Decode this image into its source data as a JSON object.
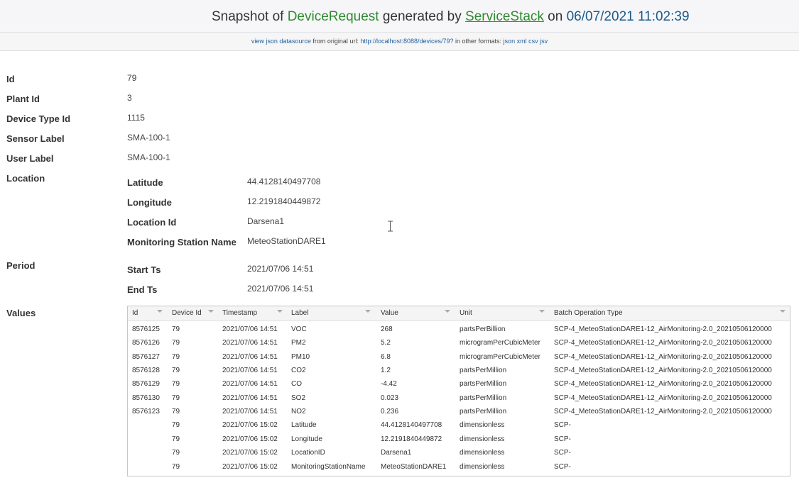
{
  "header": {
    "prefix": "Snapshot of ",
    "dto_name": "DeviceRequest",
    "generated_by": " generated by ",
    "servicestack": "ServiceStack",
    "on": " on ",
    "datetime": "06/07/2021 11:02:39"
  },
  "subheader": {
    "view_json": "view json datasource",
    "from_original": " from original url: ",
    "url": "http://localhost:8088/devices/79?",
    "other_formats": " in other formats: ",
    "formats": [
      "json",
      "xml",
      "csv",
      "jsv"
    ]
  },
  "fields": {
    "id": {
      "label": "Id",
      "value": "79"
    },
    "plant_id": {
      "label": "Plant Id",
      "value": "3"
    },
    "device_type_id": {
      "label": "Device Type Id",
      "value": "1115"
    },
    "sensor_label": {
      "label": "Sensor Label",
      "value": "SMA-100-1"
    },
    "user_label": {
      "label": "User Label",
      "value": "SMA-100-1"
    },
    "location": {
      "label": "Location",
      "latitude": {
        "label": "Latitude",
        "value": "44.4128140497708"
      },
      "longitude": {
        "label": "Longitude",
        "value": "12.2191840449872"
      },
      "location_id": {
        "label": "Location Id",
        "value": "Darsena1"
      },
      "monitoring_station_name": {
        "label": "Monitoring Station Name",
        "value": "MeteoStationDARE1"
      }
    },
    "period": {
      "label": "Period",
      "start_ts": {
        "label": "Start Ts",
        "value": "2021/07/06 14:51"
      },
      "end_ts": {
        "label": "End Ts",
        "value": "2021/07/06 14:51"
      }
    },
    "values_label": "Values"
  },
  "values_table": {
    "columns": [
      "Id",
      "Device Id",
      "Timestamp",
      "Label",
      "Value",
      "Unit",
      "Batch Operation Type"
    ],
    "rows": [
      [
        "8576125",
        "79",
        "2021/07/06 14:51",
        "VOC",
        "268",
        "partsPerBillion",
        "SCP-4_MeteoStationDARE1-12_AirMonitoring-2.0_20210506120000"
      ],
      [
        "8576126",
        "79",
        "2021/07/06 14:51",
        "PM2",
        "5.2",
        "microgramPerCubicMeter",
        "SCP-4_MeteoStationDARE1-12_AirMonitoring-2.0_20210506120000"
      ],
      [
        "8576127",
        "79",
        "2021/07/06 14:51",
        "PM10",
        "6.8",
        "microgramPerCubicMeter",
        "SCP-4_MeteoStationDARE1-12_AirMonitoring-2.0_20210506120000"
      ],
      [
        "8576128",
        "79",
        "2021/07/06 14:51",
        "CO2",
        "1.2",
        "partsPerMillion",
        "SCP-4_MeteoStationDARE1-12_AirMonitoring-2.0_20210506120000"
      ],
      [
        "8576129",
        "79",
        "2021/07/06 14:51",
        "CO",
        "-4.42",
        "partsPerMillion",
        "SCP-4_MeteoStationDARE1-12_AirMonitoring-2.0_20210506120000"
      ],
      [
        "8576130",
        "79",
        "2021/07/06 14:51",
        "SO2",
        "0.023",
        "partsPerMillion",
        "SCP-4_MeteoStationDARE1-12_AirMonitoring-2.0_20210506120000"
      ],
      [
        "8576123",
        "79",
        "2021/07/06 14:51",
        "NO2",
        "0.236",
        "partsPerMillion",
        "SCP-4_MeteoStationDARE1-12_AirMonitoring-2.0_20210506120000"
      ],
      [
        "",
        "79",
        "2021/07/06 15:02",
        "Latitude",
        "44.4128140497708",
        "dimensionless",
        "SCP-"
      ],
      [
        "",
        "79",
        "2021/07/06 15:02",
        "Longitude",
        "12.2191840449872",
        "dimensionless",
        "SCP-"
      ],
      [
        "",
        "79",
        "2021/07/06 15:02",
        "LocationID",
        "Darsena1",
        "dimensionless",
        "SCP-"
      ],
      [
        "",
        "79",
        "2021/07/06 15:02",
        "MonitoringStationName",
        "MeteoStationDARE1",
        "dimensionless",
        "SCP-"
      ]
    ]
  },
  "colors": {
    "brand_green": "#2e8b2e",
    "date_blue": "#1a5a8a",
    "link_blue": "#1f5f9f"
  },
  "icons": {
    "cursor": "text-cursor-icon",
    "sort": "sort-caret-icon"
  }
}
